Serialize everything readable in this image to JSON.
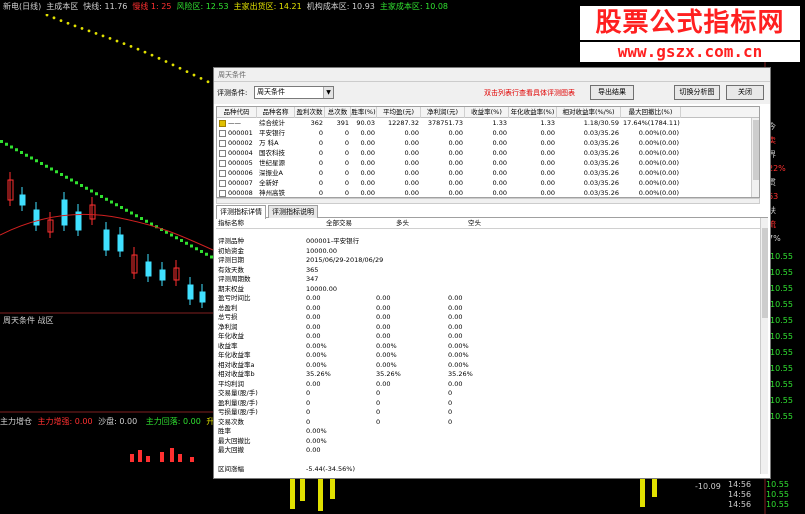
{
  "topbar": {
    "items": [
      {
        "text": "新电(日线)",
        "color": "w"
      },
      {
        "text": "主成本区",
        "color": "w"
      },
      {
        "text": "快线: 11.76",
        "color": "w"
      },
      {
        "text": "慢线 1: 25",
        "color": "r"
      },
      {
        "text": "风险区: 12.53",
        "color": "g"
      },
      {
        "text": "主家出货区: 14.21",
        "color": "y"
      },
      {
        "text": "机构成本区: 10.93",
        "color": "w"
      },
      {
        "text": "主家成本区: 10.08",
        "color": "g"
      }
    ]
  },
  "watermark": {
    "title": "股票公式指标网",
    "url": "www.gszx.com.cn"
  },
  "left_labels": {
    "indicator_name": "周天条件 战区",
    "bottom_line": {
      "a": "主力增仓",
      "b": "主力增强: 0.00",
      "c": "沙盘: 0.00",
      "d": "主力回落: 0.00",
      "e": "升"
    }
  },
  "right_panel": {
    "prices": [
      "10.55",
      "10.55",
      "10.55",
      "10.55",
      "10.55",
      "10.55",
      "10.55",
      "10.55",
      "10.55",
      "10.55",
      "10.55"
    ],
    "times": [
      "14:56",
      "14:56",
      "14:56"
    ],
    "side_chars": [
      "今",
      "卖",
      "界",
      "22%",
      "贯",
      "63",
      "扶",
      "流",
      "7%"
    ],
    "bottom_val": "-10.09"
  },
  "dialog": {
    "title": "周天条件",
    "toolbar": {
      "condition_label": "评测条件:",
      "condition_value": "周天条件",
      "hint": "双击列表行查看具体评测图表",
      "export_label": "导出结果",
      "switch_label": "切换分析图",
      "close_label": "关闭"
    },
    "summary_table": {
      "headers": [
        "品种代码",
        "品种名称",
        "盈利次数",
        "总次数",
        "胜率(%)",
        "平均盈(元)",
        "净利润(元)",
        "收益率(%)",
        "年化收益率(%)",
        "相对收益率(%/%)",
        "最大回撤比(%)"
      ],
      "rows": [
        [
          "——",
          "综合统计",
          "362",
          "391",
          "90.03",
          "12287.32",
          "378751.73",
          "1.33",
          "1.33",
          "1.18/30.59",
          "17.64%(1784.11)"
        ],
        [
          "000001",
          "平安银行",
          "0",
          "0",
          "0.00",
          "0.00",
          "0.00",
          "0.00",
          "0.00",
          "0.03/35.26",
          "0.00%(0.00)"
        ],
        [
          "000002",
          "万 科A",
          "0",
          "0",
          "0.00",
          "0.00",
          "0.00",
          "0.00",
          "0.00",
          "0.03/35.26",
          "0.00%(0.00)"
        ],
        [
          "000004",
          "国农科技",
          "0",
          "0",
          "0.00",
          "0.00",
          "0.00",
          "0.00",
          "0.00",
          "0.03/35.26",
          "0.00%(0.00)"
        ],
        [
          "000005",
          "世纪星源",
          "0",
          "0",
          "0.00",
          "0.00",
          "0.00",
          "0.00",
          "0.00",
          "0.03/35.26",
          "0.00%(0.00)"
        ],
        [
          "000006",
          "深振业A",
          "0",
          "0",
          "0.00",
          "0.00",
          "0.00",
          "0.00",
          "0.00",
          "0.03/35.26",
          "0.00%(0.00)"
        ],
        [
          "000007",
          "全新好",
          "0",
          "0",
          "0.00",
          "0.00",
          "0.00",
          "0.00",
          "0.00",
          "0.03/35.26",
          "0.00%(0.00)"
        ],
        [
          "000008",
          "神州高铁",
          "0",
          "0",
          "0.00",
          "0.00",
          "0.00",
          "0.00",
          "0.00",
          "0.03/35.26",
          "0.00%(0.00)"
        ]
      ]
    },
    "tabs": [
      "评测指标详情",
      "评测指标说明"
    ],
    "detail_table": {
      "headers": [
        "指标名称",
        "全部交易",
        "多头",
        "空头"
      ],
      "rows": [
        [
          "评测品种",
          "000001-平安银行",
          "",
          ""
        ],
        [
          "初始资金",
          "10000.00",
          "",
          ""
        ],
        [
          "评测日期",
          "2015/06/29-2018/06/29",
          "",
          ""
        ],
        [
          "有效天数",
          "365",
          "",
          ""
        ],
        [
          "评测周期数",
          "347",
          "",
          ""
        ],
        [
          "期末权益",
          "10000.00",
          "",
          ""
        ],
        [
          "盈亏时间比",
          "0.00",
          "0.00",
          "0.00"
        ],
        [
          "总盈利",
          "0.00",
          "0.00",
          "0.00"
        ],
        [
          "总亏损",
          "0.00",
          "0.00",
          "0.00"
        ],
        [
          "净利润",
          "0.00",
          "0.00",
          "0.00"
        ],
        [
          "年化收益",
          "0.00",
          "0.00",
          "0.00"
        ],
        [
          "收益率",
          "0.00%",
          "0.00%",
          "0.00%"
        ],
        [
          "年化收益率",
          "0.00%",
          "0.00%",
          "0.00%"
        ],
        [
          "相对收益率a",
          "0.00%",
          "0.00%",
          "0.00%"
        ],
        [
          "相对收益率b",
          "35.26%",
          "35.26%",
          "35.26%"
        ],
        [
          "平均利润",
          "0.00",
          "0.00",
          "0.00"
        ],
        [
          "交易量(股/手)",
          "0",
          "0",
          "0"
        ],
        [
          "盈利量(股/手)",
          "0",
          "0",
          "0"
        ],
        [
          "亏损量(股/手)",
          "0",
          "0",
          "0"
        ],
        [
          "交易次数",
          "0",
          "0",
          "0"
        ],
        [
          "胜率",
          "0.00%",
          "",
          ""
        ],
        [
          "最大回撤比",
          "0.00%",
          "",
          ""
        ],
        [
          "最大回撤",
          "0.00",
          "",
          ""
        ],
        [
          "",
          "",
          "",
          ""
        ],
        [
          "区间涨幅",
          "-5.44(-34.56%)",
          "",
          ""
        ]
      ]
    }
  },
  "colors": {
    "green": "#30e030",
    "red": "#ff3030",
    "yellow": "#e0e000",
    "cyan": "#40e0ff",
    "bg": "#000000"
  }
}
